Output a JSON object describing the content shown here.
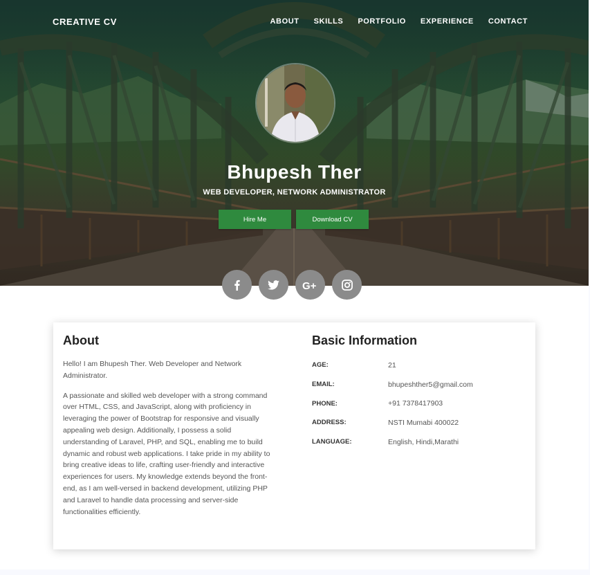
{
  "brand": "CREATIVE CV",
  "nav": [
    "ABOUT",
    "SKILLS",
    "PORTFOLIO",
    "EXPERIENCE",
    "CONTACT"
  ],
  "hero": {
    "name": "Bhupesh Ther",
    "subtitle": "WEB DEVELOPER, NETWORK ADMINISTRATOR",
    "hire_label": "Hire Me",
    "download_label": "Download CV"
  },
  "social": [
    "facebook-icon",
    "twitter-icon",
    "google-plus-icon",
    "instagram-icon"
  ],
  "about": {
    "title": "About",
    "p1": "Hello! I am Bhupesh Ther. Web Developer and Network Administrator.",
    "p2": "A passionate and skilled web developer with a strong command over HTML, CSS, and JavaScript, along with proficiency in leveraging the power of Bootstrap for responsive and visually appealing web design. Additionally, I possess a solid understanding of Laravel, PHP, and SQL, enabling me to build dynamic and robust web applications. I take pride in my ability to bring creative ideas to life, crafting user-friendly and interactive experiences for users. My knowledge extends beyond the front-end, as I am well-versed in backend development, utilizing PHP and Laravel to handle data processing and server-side functionalities efficiently."
  },
  "basic_info": {
    "title": "Basic Information",
    "rows": [
      {
        "label": "AGE:",
        "value": "21"
      },
      {
        "label": "EMAIL:",
        "value": "bhupeshther5@gmail.com"
      },
      {
        "label": "PHONE:",
        "value": "+91 7378417903"
      },
      {
        "label": "ADDRESS:",
        "value": "NSTI Mumabi 400022"
      },
      {
        "label": "LANGUAGE:",
        "value": "English, Hindi,Marathi"
      }
    ]
  },
  "colors": {
    "button_green": "#2f8a3e",
    "social_gray": "#8b8b8b"
  }
}
